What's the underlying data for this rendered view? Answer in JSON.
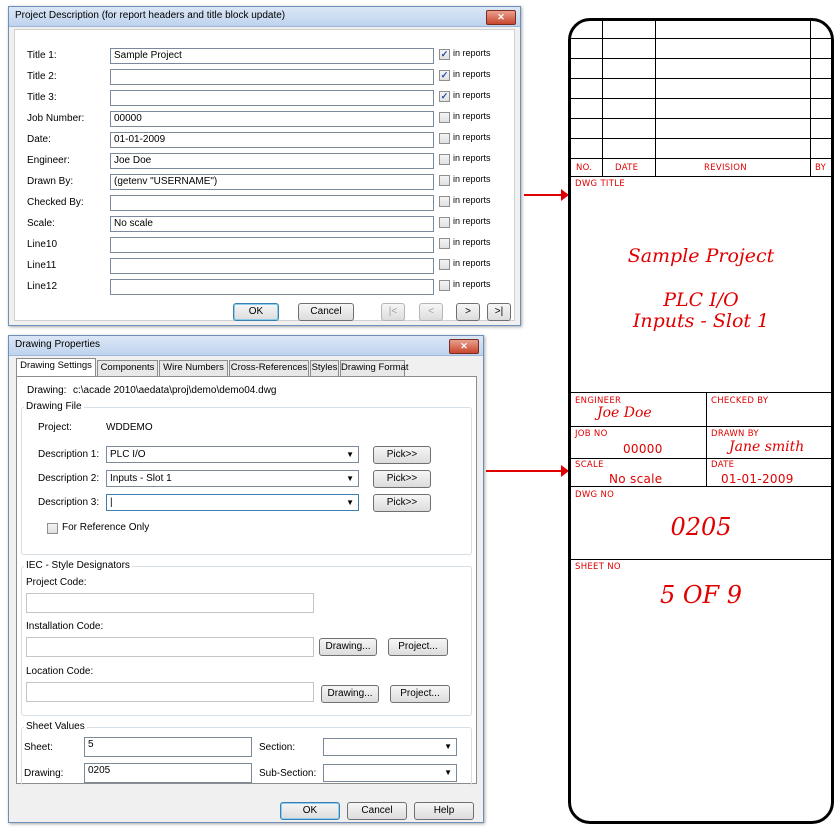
{
  "project_dialog": {
    "title": "Project Description  (for report headers and title block update)",
    "close_label": "✕",
    "check_label": "in reports",
    "rows": [
      {
        "label": "Title 1:",
        "value": "Sample Project",
        "checked": true
      },
      {
        "label": "Title 2:",
        "value": "",
        "checked": true
      },
      {
        "label": "Title 3:",
        "value": "",
        "checked": true
      },
      {
        "label": "Job Number:",
        "value": "00000",
        "checked": false
      },
      {
        "label": "Date:",
        "value": "01-01-2009",
        "checked": false
      },
      {
        "label": "Engineer:",
        "value": "Joe Doe",
        "checked": false
      },
      {
        "label": "Drawn By:",
        "value": "(getenv \"USERNAME\")",
        "checked": false
      },
      {
        "label": "Checked By:",
        "value": "",
        "checked": false
      },
      {
        "label": "Scale:",
        "value": "No scale",
        "checked": false
      },
      {
        "label": "Line10",
        "value": "",
        "checked": false
      },
      {
        "label": "Line11",
        "value": "",
        "checked": false
      },
      {
        "label": "Line12",
        "value": "",
        "checked": false
      }
    ],
    "ok_label": "OK",
    "cancel_label": "Cancel",
    "nav": {
      "first": "|<",
      "prev": "<",
      "next": ">",
      "last": ">|"
    }
  },
  "drawing_dialog": {
    "title": "Drawing Properties",
    "close_label": "✕",
    "tabs": [
      "Drawing Settings",
      "Components",
      "Wire Numbers",
      "Cross-References",
      "Styles",
      "Drawing Format"
    ],
    "drawing_label": "Drawing:",
    "drawing_path": "c:\\acade 2010\\aedata\\proj\\demo\\demo04.dwg",
    "drawing_file_group": "Drawing File",
    "project_label": "Project:",
    "project_value": "WDDEMO",
    "descriptions": [
      {
        "label": "Description 1:",
        "value": "PLC I/O"
      },
      {
        "label": "Description 2:",
        "value": "Inputs - Slot 1"
      },
      {
        "label": "Description 3:",
        "value": "|"
      }
    ],
    "pick_label": "Pick>>",
    "reference_label": "For Reference Only",
    "iec_group": "IEC - Style Designators",
    "project_code_label": "Project Code:",
    "installation_code_label": "Installation Code:",
    "location_code_label": "Location Code:",
    "drawing_btn_label": "Drawing...",
    "project_btn_label": "Project...",
    "sheet_values_group": "Sheet Values",
    "sheet_label": "Sheet:",
    "sheet_value": "5",
    "drawing_num_label": "Drawing:",
    "drawing_num_value": "0205",
    "section_label": "Section:",
    "subsection_label": "Sub-Section:",
    "ok_label": "OK",
    "cancel_label": "Cancel",
    "help_label": "Help"
  },
  "title_block": {
    "rev_headers": {
      "no": "NO.",
      "date": "DATE",
      "revision": "REVISION",
      "by": "BY"
    },
    "dwg_title_label": "DWG TITLE",
    "title_line1": "Sample Project",
    "title_line2": "PLC I/O",
    "title_line3": "Inputs - Slot 1",
    "engineer_label": "ENGINEER",
    "engineer_value": "Joe Doe",
    "checked_by_label": "CHECKED BY",
    "job_no_label": "JOB NO",
    "job_no_value": "00000",
    "drawn_by_label": "DRAWN BY",
    "drawn_by_value": "Jane smith",
    "scale_label": "SCALE",
    "scale_value": "No scale",
    "date_label": "DATE",
    "date_value": "01-01-2009",
    "dwg_no_label": "DWG NO",
    "dwg_no_value": "0205",
    "sheet_no_label": "SHEET NO",
    "sheet_no_value": "5 OF 9"
  },
  "colors": {
    "accent": "#e00000"
  }
}
